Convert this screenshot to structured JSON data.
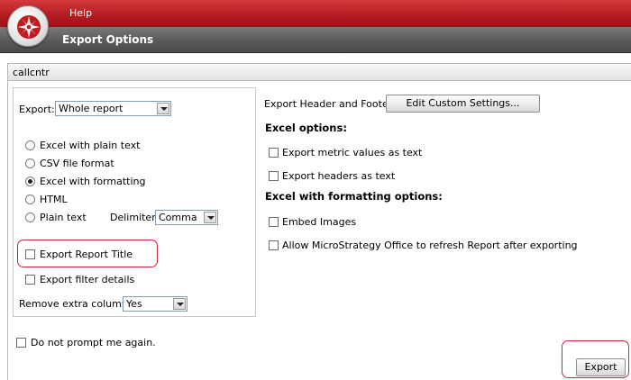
{
  "app": {
    "menu_help": "Help",
    "window_title": "Export Options",
    "logo_icon": "microstrategy-logo-icon",
    "accent_color": "#b51d22"
  },
  "report": {
    "name": "callcntr"
  },
  "left": {
    "export_label": "Export:",
    "export_select_value": "Whole report",
    "formats": [
      {
        "label": "Excel with plain text",
        "selected": false
      },
      {
        "label": "CSV file format",
        "selected": false
      },
      {
        "label": "Excel with formatting",
        "selected": true
      },
      {
        "label": "HTML",
        "selected": false
      },
      {
        "label": "Plain text",
        "selected": false
      }
    ],
    "delimiter_label": "Delimiter:",
    "delimiter_value": "Comma",
    "export_report_title": "Export Report Title",
    "export_filter_details": "Export filter details",
    "remove_extra_column_label": "Remove extra column:",
    "remove_extra_column_value": "Yes"
  },
  "right": {
    "header_footer_label": "Export Header and Footer:",
    "edit_custom_settings_button": "Edit Custom Settings...",
    "excel_options_heading": "Excel options:",
    "export_metric_values_as_text": "Export metric values as text",
    "export_headers_as_text": "Export headers as text",
    "excel_formatting_heading": "Excel with formatting options:",
    "embed_images": "Embed Images",
    "allow_refresh": "Allow MicroStrategy Office to refresh Report after exporting"
  },
  "footer": {
    "do_not_prompt": "Do not prompt me again.",
    "export_button": "Export"
  }
}
